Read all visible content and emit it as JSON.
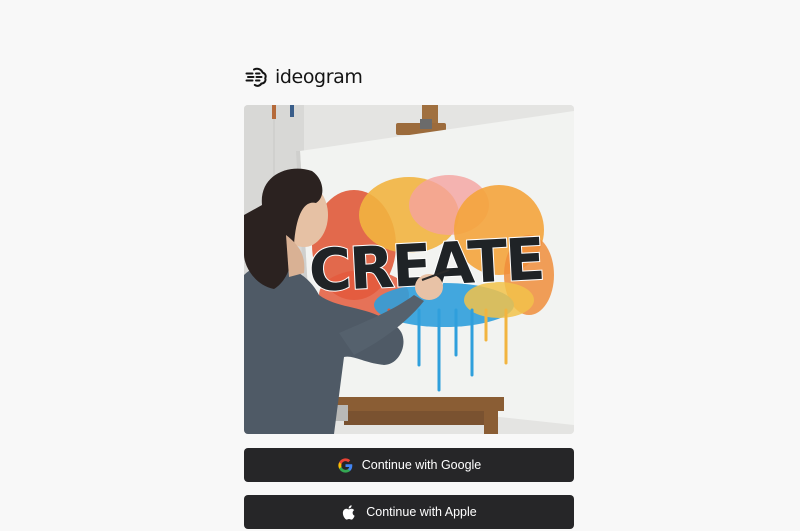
{
  "brand": {
    "name": "ideogram",
    "logo_icon": "ideogram-logo-icon"
  },
  "hero_image": {
    "depicts": "painter-at-easel",
    "painted_word": "CREATE"
  },
  "auth": {
    "google_label": "Continue with Google",
    "google_icon": "google-icon",
    "apple_label": "Continue with Apple",
    "apple_icon": "apple-icon"
  },
  "colors": {
    "page_background": "#f8f8f8",
    "button_background": "#262628",
    "button_text": "#ffffff",
    "brand_text": "#141414"
  }
}
